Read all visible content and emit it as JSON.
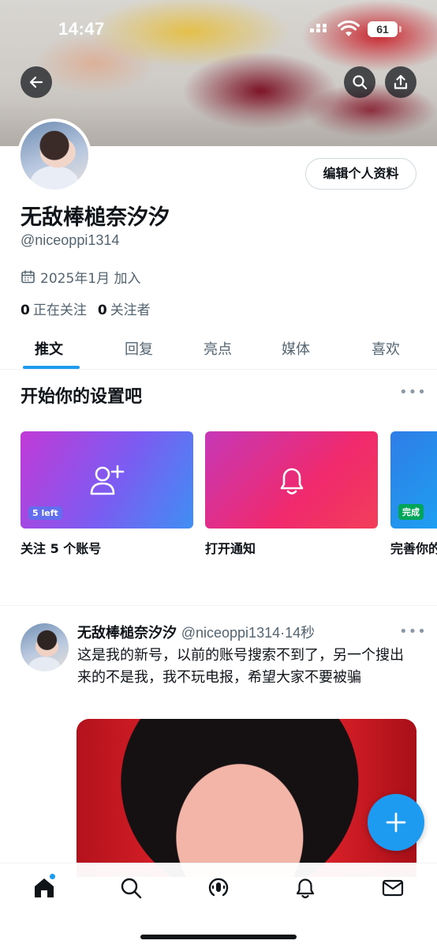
{
  "status_bar": {
    "time": "14:47",
    "battery": "61"
  },
  "header": {
    "icons": [
      "back-arrow-icon",
      "search-icon",
      "share-icon"
    ]
  },
  "profile": {
    "edit_button": "编辑个人资料",
    "display_name": "无敌棒槌奈汐汐",
    "handle": "@niceoppi1314",
    "joined": "2025年1月 加入",
    "following_count": "0",
    "following_label": "正在关注",
    "followers_count": "0",
    "followers_label": "关注者"
  },
  "tabs": [
    "推文",
    "回复",
    "亮点",
    "媒体",
    "喜欢"
  ],
  "active_tab": "推文",
  "setup": {
    "title": "开始你的设置吧",
    "cards": [
      {
        "badge": "5 left",
        "label": "关注 5 个账号",
        "icon": "add-user-icon"
      },
      {
        "badge": "",
        "label": "打开通知",
        "icon": "bell-icon"
      },
      {
        "badge": "完成",
        "label": "完善你的",
        "icon": ""
      }
    ]
  },
  "post": {
    "name": "无敌棒槌奈汐汐",
    "meta": "@niceoppi1314·14秒",
    "text": "这是我的新号，以前的账号搜索不到了，另一个搜出来的不是我，我不玩电报，希望大家不要被骗"
  },
  "bottom_nav": [
    "home-icon",
    "search-icon",
    "spaces-icon",
    "notifications-icon",
    "messages-icon"
  ],
  "colors": {
    "accent": "#1d9bf0",
    "text": "#0f1419",
    "muted": "#536471"
  }
}
